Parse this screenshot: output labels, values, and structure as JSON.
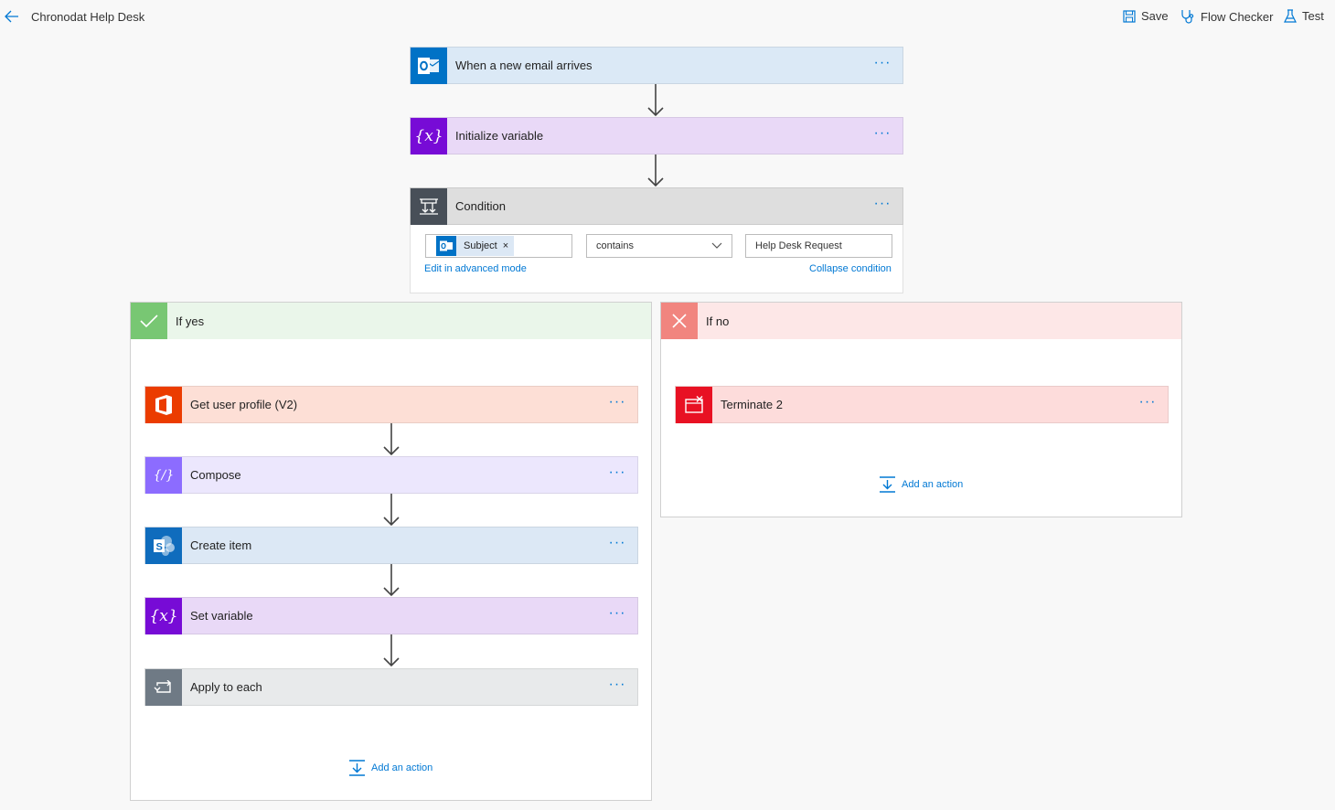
{
  "header": {
    "title": "Chronodat Help Desk",
    "save_label": "Save",
    "flow_checker_label": "Flow Checker",
    "test_label": "Test"
  },
  "colors": {
    "accent": "#0078d4",
    "outlook": "#0072c6",
    "variable": "#770bd6",
    "condition": "#484f58",
    "office": "#eb3c00",
    "compose": "#8c6cff",
    "sharepoint": "#036c70",
    "loop": "#6f7a85",
    "terminate": "#e81123"
  },
  "flow": {
    "trigger": {
      "label": "When a new email arrives",
      "icon": "outlook-icon"
    },
    "init_variable": {
      "label": "Initialize variable",
      "icon": "variable-icon"
    },
    "condition": {
      "label": "Condition",
      "icon": "condition-icon",
      "token_label": "Subject",
      "token_remove": "×",
      "operator": "contains",
      "value": "Help Desk Request",
      "advanced_link": "Edit in advanced mode",
      "collapse_link": "Collapse condition"
    }
  },
  "branches": {
    "yes": {
      "label": "If yes",
      "actions": [
        {
          "label": "Get user profile (V2)",
          "icon": "office-icon"
        },
        {
          "label": "Compose",
          "icon": "compose-icon"
        },
        {
          "label": "Create item",
          "icon": "sharepoint-icon"
        },
        {
          "label": "Set variable",
          "icon": "variable-icon"
        },
        {
          "label": "Apply to each",
          "icon": "loop-icon"
        }
      ],
      "add_action": "Add an action"
    },
    "no": {
      "label": "If no",
      "actions": [
        {
          "label": "Terminate 2",
          "icon": "terminate-icon"
        }
      ],
      "add_action": "Add an action"
    }
  },
  "more_glyph": "···"
}
